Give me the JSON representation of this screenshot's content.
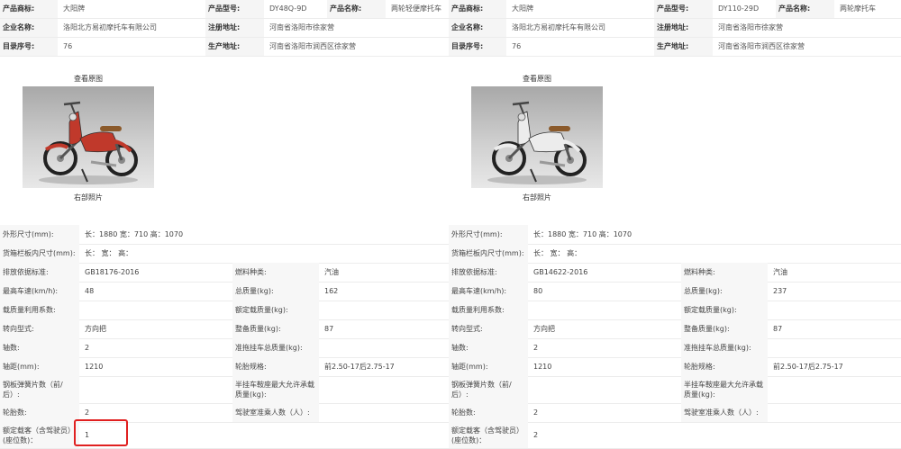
{
  "labels": {
    "brand": "产品商标:",
    "model": "产品型号:",
    "name": "产品名称:",
    "company": "企业名称:",
    "reg_addr": "注册地址:",
    "catalog": "目录序号:",
    "prod_addr": "生产地址:",
    "view_original": "查看原图",
    "right_photo": "右部照片",
    "dimensions": "外形尺寸(mm):",
    "cargo": "货箱栏板内尺寸(mm):",
    "emission": "排放依据标准:",
    "fuel": "燃料种类:",
    "speed": "最高车速(km/h):",
    "total_mass": "总质量(kg):",
    "load_factor": "载质量利用系数:",
    "rated_load": "额定载质量(kg):",
    "steering": "转向型式:",
    "curb_mass": "整备质量(kg):",
    "axles": "轴数:",
    "trailer_mass": "准拖挂车总质量(kg):",
    "wheelbase": "轴距(mm):",
    "tire": "轮胎规格:",
    "spring": "钢板弹簧片数（前/后）:",
    "semi_trailer": "半挂车鞍座最大允许承载质量(kg):",
    "tires": "轮胎数:",
    "cab": "驾驶室准乘人数（人）:",
    "seats": "额定载客（含驾驶员）(座位数)："
  },
  "left": {
    "brand": "大阳牌",
    "model": "DY48Q-9D",
    "name": "两轮轻便摩托车",
    "company": "洛阳北方易初摩托车有限公司",
    "reg_addr": "河南省洛阳市徐家营",
    "catalog": "76",
    "prod_addr": "河南省洛阳市涧西区徐家营",
    "dimensions": "长：1880 宽：710 高：1070",
    "cargo": "长： 宽： 高：",
    "emission": "GB18176-2016",
    "fuel": "汽油",
    "speed": "48",
    "total_mass": "162",
    "load_factor": "",
    "rated_load": "",
    "steering": "方向把",
    "curb_mass": "87",
    "axles": "2",
    "trailer_mass": "",
    "wheelbase": "1210",
    "tire": "前2.50-17后2.75-17",
    "spring": "",
    "semi_trailer": "",
    "tires": "2",
    "cab": "",
    "seats": "1",
    "body_color": "#c0392b"
  },
  "right": {
    "brand": "大阳牌",
    "model": "DY110-29D",
    "name": "两轮摩托车",
    "company": "洛阳北方易初摩托车有限公司",
    "reg_addr": "河南省洛阳市徐家营",
    "catalog": "76",
    "prod_addr": "河南省洛阳市涧西区徐家营",
    "dimensions": "长：1880 宽：710 高：1070",
    "cargo": "长： 宽： 高：",
    "emission": "GB14622-2016",
    "fuel": "汽油",
    "speed": "80",
    "total_mass": "237",
    "load_factor": "",
    "rated_load": "",
    "steering": "方向把",
    "curb_mass": "87",
    "axles": "2",
    "trailer_mass": "",
    "wheelbase": "1210",
    "tire": "前2.50-17后2.75-17",
    "spring": "",
    "semi_trailer": "",
    "tires": "2",
    "cab": "",
    "seats": "2",
    "body_color": "#ececec"
  },
  "colors": {
    "highlight": "#e02020",
    "label_bg": "#f5f5f5"
  }
}
